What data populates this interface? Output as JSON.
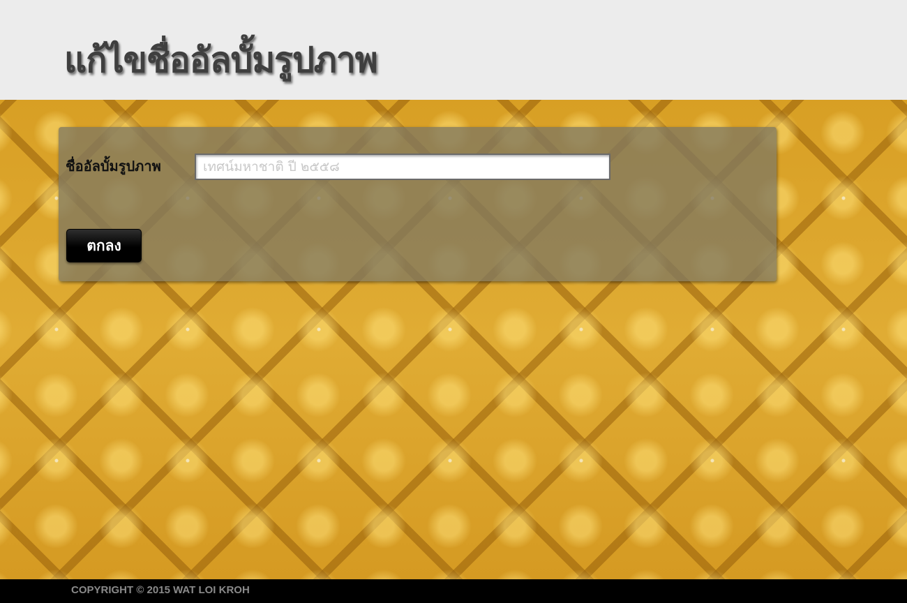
{
  "header": {
    "title": "แก้ไขชื่ออัลบั้มรูปภาพ"
  },
  "form": {
    "album_name_label": "ชื่ออัลบั้มรูปภาพ",
    "album_name_placeholder": "เทศน์มหาชาติ ปี ๒๕๕๘",
    "album_name_value": "",
    "submit_label": "ตกลง"
  },
  "footer": {
    "copyright": "COPYRIGHT © 2015 WAT LOI KROH"
  },
  "colors": {
    "header_bg": "#ececec",
    "title_text": "#3f3f3f",
    "background_gold": "#d7a028",
    "panel_overlay": "#807860",
    "button_bg": "#000000",
    "footer_bg": "#000000",
    "footer_text": "#8a8a8a"
  }
}
